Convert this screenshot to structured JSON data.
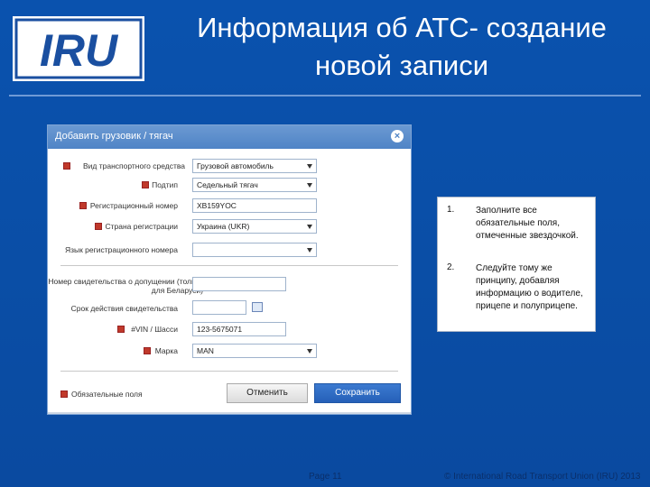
{
  "slide": {
    "title_line1": "Информация об АТС- создание",
    "title_line2": "новой записи",
    "logo_text": "IRU"
  },
  "dialog": {
    "title": "Добавить грузовик / тягач",
    "fields": [
      {
        "label": "Вид транспортного средства",
        "value": "Грузовой автомобиль",
        "required": true,
        "type": "select"
      },
      {
        "label": "Подтип",
        "value": "Седельный тягач",
        "required": true,
        "type": "select"
      },
      {
        "label": "Регистрационный номер",
        "value": "XB159YOC",
        "required": true,
        "type": "text"
      },
      {
        "label": "Страна регистрации",
        "value": "Украина (UKR)",
        "required": true,
        "type": "select"
      },
      {
        "label": "Язык регистрационного номера",
        "value": "",
        "required": false,
        "type": "select"
      },
      {
        "label": "Номер свидетельства о допущении (только для Беларуси)",
        "value": "",
        "required": false,
        "type": "text"
      },
      {
        "label": "Срок действия свидетельства",
        "value": "",
        "required": false,
        "type": "date"
      },
      {
        "label": "#VIN / Шасси",
        "value": "123-5675071",
        "required": true,
        "type": "text"
      },
      {
        "label": "Марка",
        "value": "MAN",
        "required": true,
        "type": "select"
      }
    ],
    "required_note": "Обязательные поля",
    "cancel_label": "Отменить",
    "save_label": "Сохранить"
  },
  "instructions": [
    {
      "num": "1.",
      "text": "Заполните все обязательные поля, отмеченные звездочкой."
    },
    {
      "num": "2.",
      "text": "Следуйте тому же принципу, добавляя информацию о водителе, прицепе и полуприцепе."
    }
  ],
  "footer": {
    "page": "Page 11",
    "copyright": "© International Road Transport Union (IRU) 2013"
  },
  "colors": {
    "background": "#0a4fa8",
    "logo_blue": "#1a4fa0",
    "dialog_header": "#5a8dcc",
    "save_button": "#2d6cc4",
    "required_marker": "#c0392b"
  }
}
